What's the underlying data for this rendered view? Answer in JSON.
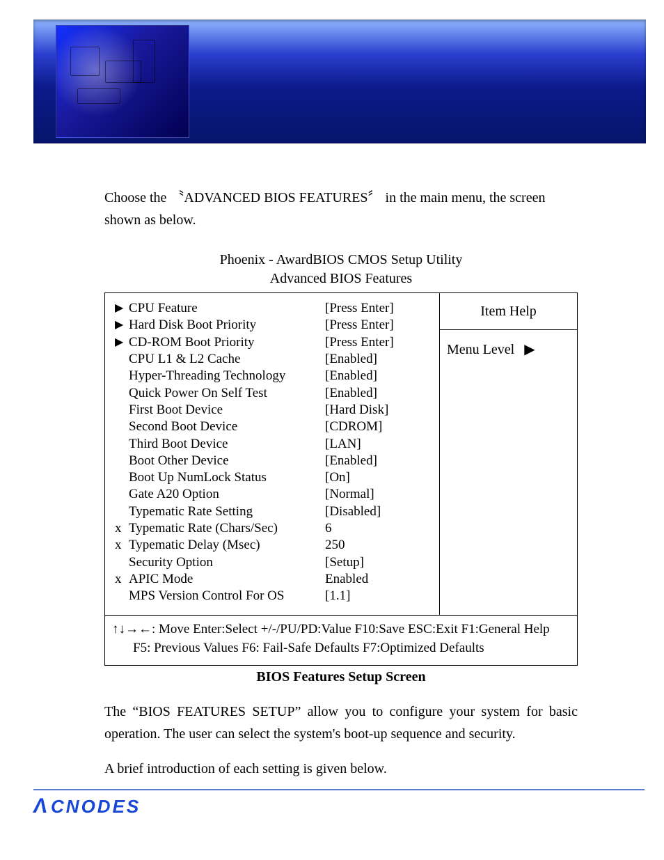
{
  "doc": {
    "intro": "Choose the 〝ADVANCED BIOS FEATURES〞 in the main menu, the screen shown as below.",
    "bios_title_1": "Phoenix - AwardBIOS CMOS Setup Utility",
    "bios_title_2": "Advanced BIOS Features",
    "caption": "BIOS Features Setup Screen",
    "para2": "The “BIOS FEATURES SETUP” allow you to configure your system for basic operation.  The user can select the system's boot-up sequence and security.",
    "para3": "A brief introduction of each setting is given below.",
    "brand": "CNODES"
  },
  "bios": {
    "items": [
      {
        "prefix": "▶",
        "label": "CPU Feature",
        "value": "[Press Enter]"
      },
      {
        "prefix": "▶",
        "label": "Hard Disk Boot Priority",
        "value": "[Press Enter]"
      },
      {
        "prefix": "▶",
        "label": "CD-ROM Boot Priority",
        "value": "[Press Enter]"
      },
      {
        "prefix": "",
        "label": "CPU L1 & L2 Cache",
        "value": "[Enabled]"
      },
      {
        "prefix": "",
        "label": "Hyper-Threading Technology",
        "value": "[Enabled]"
      },
      {
        "prefix": "",
        "label": "Quick Power On Self Test",
        "value": "[Enabled]"
      },
      {
        "prefix": "",
        "label": "First Boot Device",
        "value": "[Hard Disk]"
      },
      {
        "prefix": "",
        "label": "Second Boot Device",
        "value": "[CDROM]"
      },
      {
        "prefix": "",
        "label": "Third Boot Device",
        "value": "[LAN]"
      },
      {
        "prefix": "",
        "label": "Boot Other Device",
        "value": "[Enabled]"
      },
      {
        "prefix": "",
        "label": "Boot Up NumLock Status",
        "value": "[On]"
      },
      {
        "prefix": "",
        "label": "Gate A20 Option",
        "value": "[Normal]"
      },
      {
        "prefix": "",
        "label": "Typematic Rate Setting",
        "value": "[Disabled]"
      },
      {
        "prefix": "x",
        "label": "Typematic Rate (Chars/Sec)",
        "value": "6"
      },
      {
        "prefix": "x",
        "label": "Typematic Delay (Msec)",
        "value": "250"
      },
      {
        "prefix": "",
        "label": "Security Option",
        "value": "[Setup]"
      },
      {
        "prefix": "x",
        "label": "APIC Mode",
        "value": "Enabled"
      },
      {
        "prefix": "",
        "label": "MPS Version Control For OS",
        "value": "[1.1]"
      }
    ],
    "help_title": "Item Help",
    "help_body": "Menu Level",
    "legend1": "↑↓→←: Move   Enter:Select   +/-/PU/PD:Value   F10:Save   ESC:Exit   F1:General Help",
    "legend2": "F5: Previous Values      F6: Fail-Safe Defaults     F7:Optimized Defaults"
  }
}
